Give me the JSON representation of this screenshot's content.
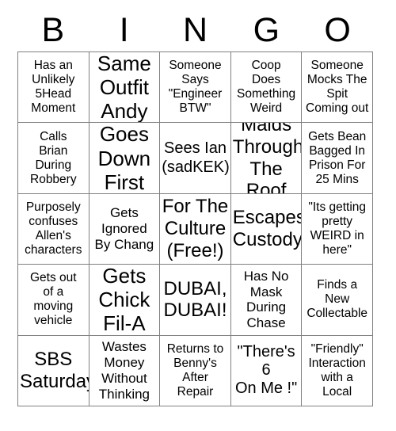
{
  "header": {
    "letters": [
      "B",
      "I",
      "N",
      "G",
      "O"
    ]
  },
  "grid": {
    "rows": 5,
    "columns": 5,
    "border_color": "#808080",
    "background_color": "#ffffff",
    "text_color": "#000000",
    "free_space_index": 12,
    "cells": [
      {
        "text": "Has an\nUnlikely\n5Head\nMoment",
        "size": "fs-sm"
      },
      {
        "text": "Same\nOutfit\nAndy",
        "size": "fs-xxl"
      },
      {
        "text": "Someone\nSays\n\"Engineer\nBTW\"",
        "size": "fs-sm"
      },
      {
        "text": "Coop\nDoes\nSomething\nWeird",
        "size": "fs-sm"
      },
      {
        "text": "Someone\nMocks The\nSpit\nComing out",
        "size": "fs-sm"
      },
      {
        "text": "Calls\nBrian\nDuring\nRobbery",
        "size": "fs-sm"
      },
      {
        "text": "Goes\nDown\nFirst",
        "size": "fs-xxl"
      },
      {
        "text": "Sees Ian\n(sadKEK)",
        "size": "fs-lg"
      },
      {
        "text": "Malds\nThrough\nThe Roof",
        "size": "fs-xl"
      },
      {
        "text": "Gets Bean\nBagged In\nPrison For\n25 Mins",
        "size": "fs-sm"
      },
      {
        "text": "Purposely\nconfuses\nAllen's\ncharacters",
        "size": "fs-sm"
      },
      {
        "text": "Gets\nIgnored\nBy Chang",
        "size": "fs-md"
      },
      {
        "text": "For The\nCulture\n(Free!)",
        "size": "fs-xl"
      },
      {
        "text": "Escapes\nCustody",
        "size": "fs-xl"
      },
      {
        "text": "\"Its getting\npretty\nWEIRD in\nhere\"",
        "size": "fs-sm"
      },
      {
        "text": "Gets out\nof a\nmoving\nvehicle",
        "size": "fs-sm"
      },
      {
        "text": "Gets\nChick\nFil-A",
        "size": "fs-xxl"
      },
      {
        "text": "DUBAI,\nDUBAI!",
        "size": "fs-xl"
      },
      {
        "text": "Has No\nMask\nDuring\nChase",
        "size": "fs-md"
      },
      {
        "text": "Finds a\nNew\nCollectable",
        "size": "fs-sm"
      },
      {
        "text": "SBS\nSaturday",
        "size": "fs-xl"
      },
      {
        "text": "Wastes\nMoney\nWithout\nThinking",
        "size": "fs-md"
      },
      {
        "text": "Returns to\nBenny's\nAfter\nRepair",
        "size": "fs-sm"
      },
      {
        "text": "\"There's\n6\nOn Me !\"",
        "size": "fs-lg"
      },
      {
        "text": "\"Friendly\"\nInteraction\nwith a\nLocal",
        "size": "fs-sm"
      }
    ]
  }
}
